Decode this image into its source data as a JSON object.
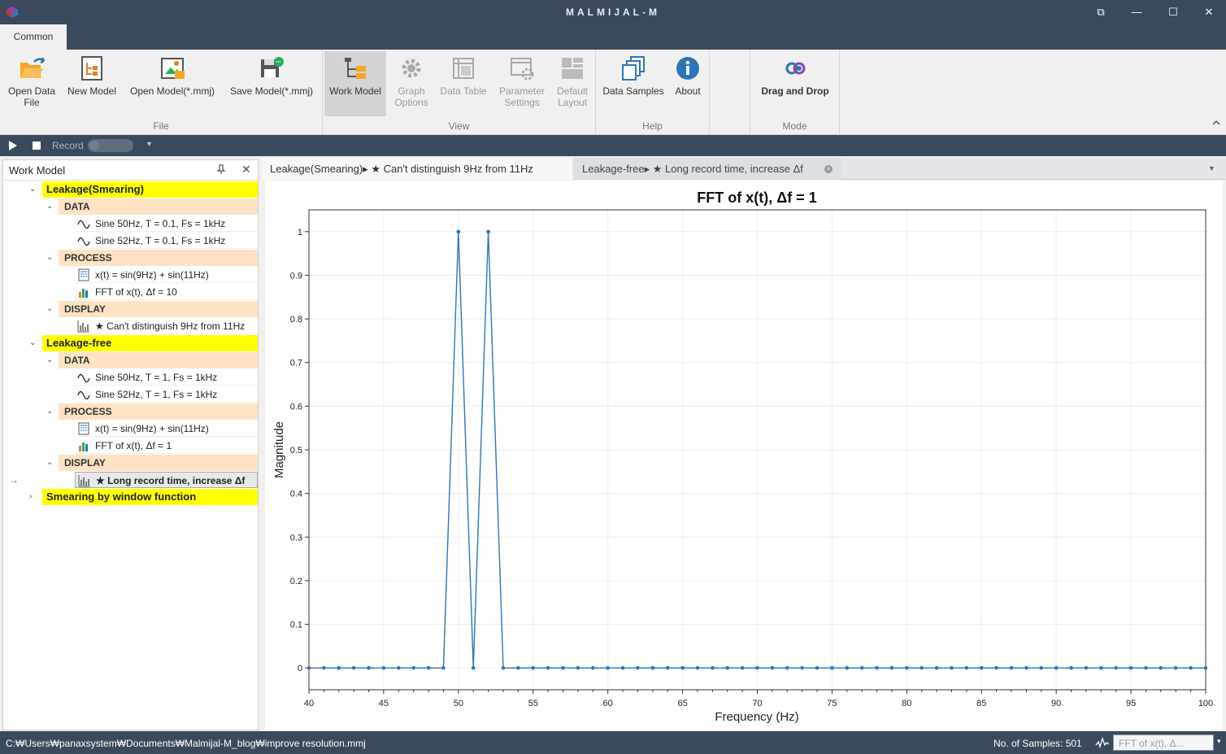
{
  "app": {
    "title": "MALMIJAL-M"
  },
  "window": {
    "restore": "⧉",
    "minimize": "—",
    "maximize": "☐",
    "close": "✕"
  },
  "ribbon": {
    "tab": "Common",
    "groups": {
      "file": "File",
      "view": "View",
      "help": "Help",
      "mode": "Mode"
    },
    "buttons": {
      "open_data_file": "Open Data File",
      "new_model": "New Model",
      "open_model": "Open Model(*.mmj)",
      "save_model": "Save Model(*.mmj)",
      "work_model": "Work Model",
      "graph_options": "Graph Options",
      "data_table": "Data Table",
      "parameter_settings": "Parameter Settings",
      "default_layout": "Default Layout",
      "data_samples": "Data Samples",
      "about": "About",
      "drag_and_drop": "Drag and Drop"
    }
  },
  "recordbar": {
    "record_label": "Record",
    "dropdown": "▾"
  },
  "work_model": {
    "title": "Work Model",
    "pin": "📌",
    "close": "✕",
    "groups": [
      {
        "label": "Leakage(Smearing)",
        "sections": [
          {
            "label": "DATA",
            "items": [
              "Sine 50Hz, T = 0.1, Fs = 1kHz",
              "Sine 52Hz, T = 0.1, Fs = 1kHz"
            ]
          },
          {
            "label": "PROCESS",
            "items": [
              "x(t) = sin(9Hz) + sin(11Hz)",
              "FFT of x(t), Δf = 10"
            ]
          },
          {
            "label": "DISPLAY",
            "items": [
              "★ Can't distinguish 9Hz from 11Hz"
            ]
          }
        ]
      },
      {
        "label": "Leakage-free",
        "sections": [
          {
            "label": "DATA",
            "items": [
              "Sine 50Hz, T = 1, Fs = 1kHz",
              "Sine 52Hz, T = 1, Fs = 1kHz"
            ]
          },
          {
            "label": "PROCESS",
            "items": [
              "x(t) = sin(9Hz) + sin(11Hz)",
              "FFT of x(t), Δf = 1"
            ]
          },
          {
            "label": "DISPLAY",
            "items": [
              "★ Long record time, increase Δf"
            ]
          }
        ]
      },
      {
        "label": "Smearing by window function",
        "sections": []
      }
    ]
  },
  "doc_tabs": [
    {
      "label": "Leakage(Smearing)▸ ★ Can't distinguish 9Hz from 11Hz"
    },
    {
      "label": "Leakage-free▸ ★ Long record time, increase Δf"
    }
  ],
  "tab_close": "×",
  "chart_data": {
    "type": "line",
    "title": "FFT of x(t), Δf = 1",
    "xlabel": "Frequency (Hz)",
    "ylabel": "Magnitude",
    "xlim": [
      40,
      100
    ],
    "ylim": [
      -0.05,
      1.05
    ],
    "xticks": [
      40,
      45,
      50,
      55,
      60,
      65,
      70,
      75,
      80,
      85,
      90,
      95,
      100
    ],
    "yticks": [
      0,
      0.1,
      0.2,
      0.3,
      0.4,
      0.5,
      0.6,
      0.7,
      0.8,
      0.9,
      1
    ],
    "ytick_labels": [
      "0",
      "0.1",
      "0.2",
      "0.3",
      "0.4",
      "0.5",
      "0.6",
      "0.7",
      "0.8",
      "0.9",
      "1"
    ],
    "grid": true,
    "color": "#2e75b6",
    "series": [
      {
        "x": [
          40,
          41,
          42,
          43,
          44,
          45,
          46,
          47,
          48,
          49,
          50,
          51,
          52,
          53,
          54,
          55,
          56,
          57,
          58,
          59,
          60,
          61,
          62,
          63,
          64,
          65,
          66,
          67,
          68,
          69,
          70,
          71,
          72,
          73,
          74,
          75,
          76,
          77,
          78,
          79,
          80,
          81,
          82,
          83,
          84,
          85,
          86,
          87,
          88,
          89,
          90,
          91,
          92,
          93,
          94,
          95,
          96,
          97,
          98,
          99,
          100
        ],
        "y": [
          0,
          0,
          0,
          0,
          0,
          0,
          0,
          0,
          0,
          0,
          1,
          0,
          1,
          0,
          0,
          0,
          0,
          0,
          0,
          0,
          0,
          0,
          0,
          0,
          0,
          0,
          0,
          0,
          0,
          0,
          0,
          0,
          0,
          0,
          0,
          0,
          0,
          0,
          0,
          0,
          0,
          0,
          0,
          0,
          0,
          0,
          0,
          0,
          0,
          0,
          0,
          0,
          0,
          0,
          0,
          0,
          0,
          0,
          0,
          0,
          0
        ]
      }
    ]
  },
  "status": {
    "path": "C:₩Users₩panaxsystem₩Documents₩Malmijal-M_blog₩improve resolution.mmj",
    "samples": "No. of Samples: 501",
    "select_value": "FFT of x(t), Δ...",
    "select_arrow": "▾"
  }
}
